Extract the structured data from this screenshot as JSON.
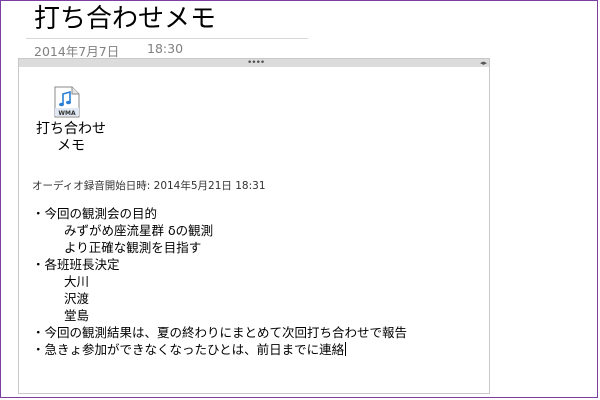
{
  "page": {
    "title": "打ち合わせメモ",
    "date": "2014年7月7日",
    "time": "18:30"
  },
  "container": {
    "move_handle_glyph": "••••",
    "resize_handle_glyph": "◂▸"
  },
  "attachment": {
    "icon": "wma-audio-file-icon",
    "icon_text": "WMA",
    "label_line1": "打ち合わせ",
    "label_line2": "メモ"
  },
  "recording": {
    "text": "オーディオ録音開始日時: 2014年5月21日  18:31"
  },
  "notes": [
    {
      "text": "・今回の観測会の目的",
      "indent": 0
    },
    {
      "text": "みずがめ座流星群 δの観測",
      "indent": 1
    },
    {
      "text": "より正確な観測を目指す",
      "indent": 1
    },
    {
      "text": "・各班班長決定",
      "indent": 0
    },
    {
      "text": "大川",
      "indent": 1
    },
    {
      "text": "沢渡",
      "indent": 1
    },
    {
      "text": "堂島",
      "indent": 1
    },
    {
      "text": "・今回の観測結果は、夏の終わりにまとめて次回打ち合わせで報告",
      "indent": 0
    },
    {
      "text": "・急きょ参加ができなくなったひとは、前日までに連絡",
      "indent": 0,
      "caret": true
    }
  ]
}
